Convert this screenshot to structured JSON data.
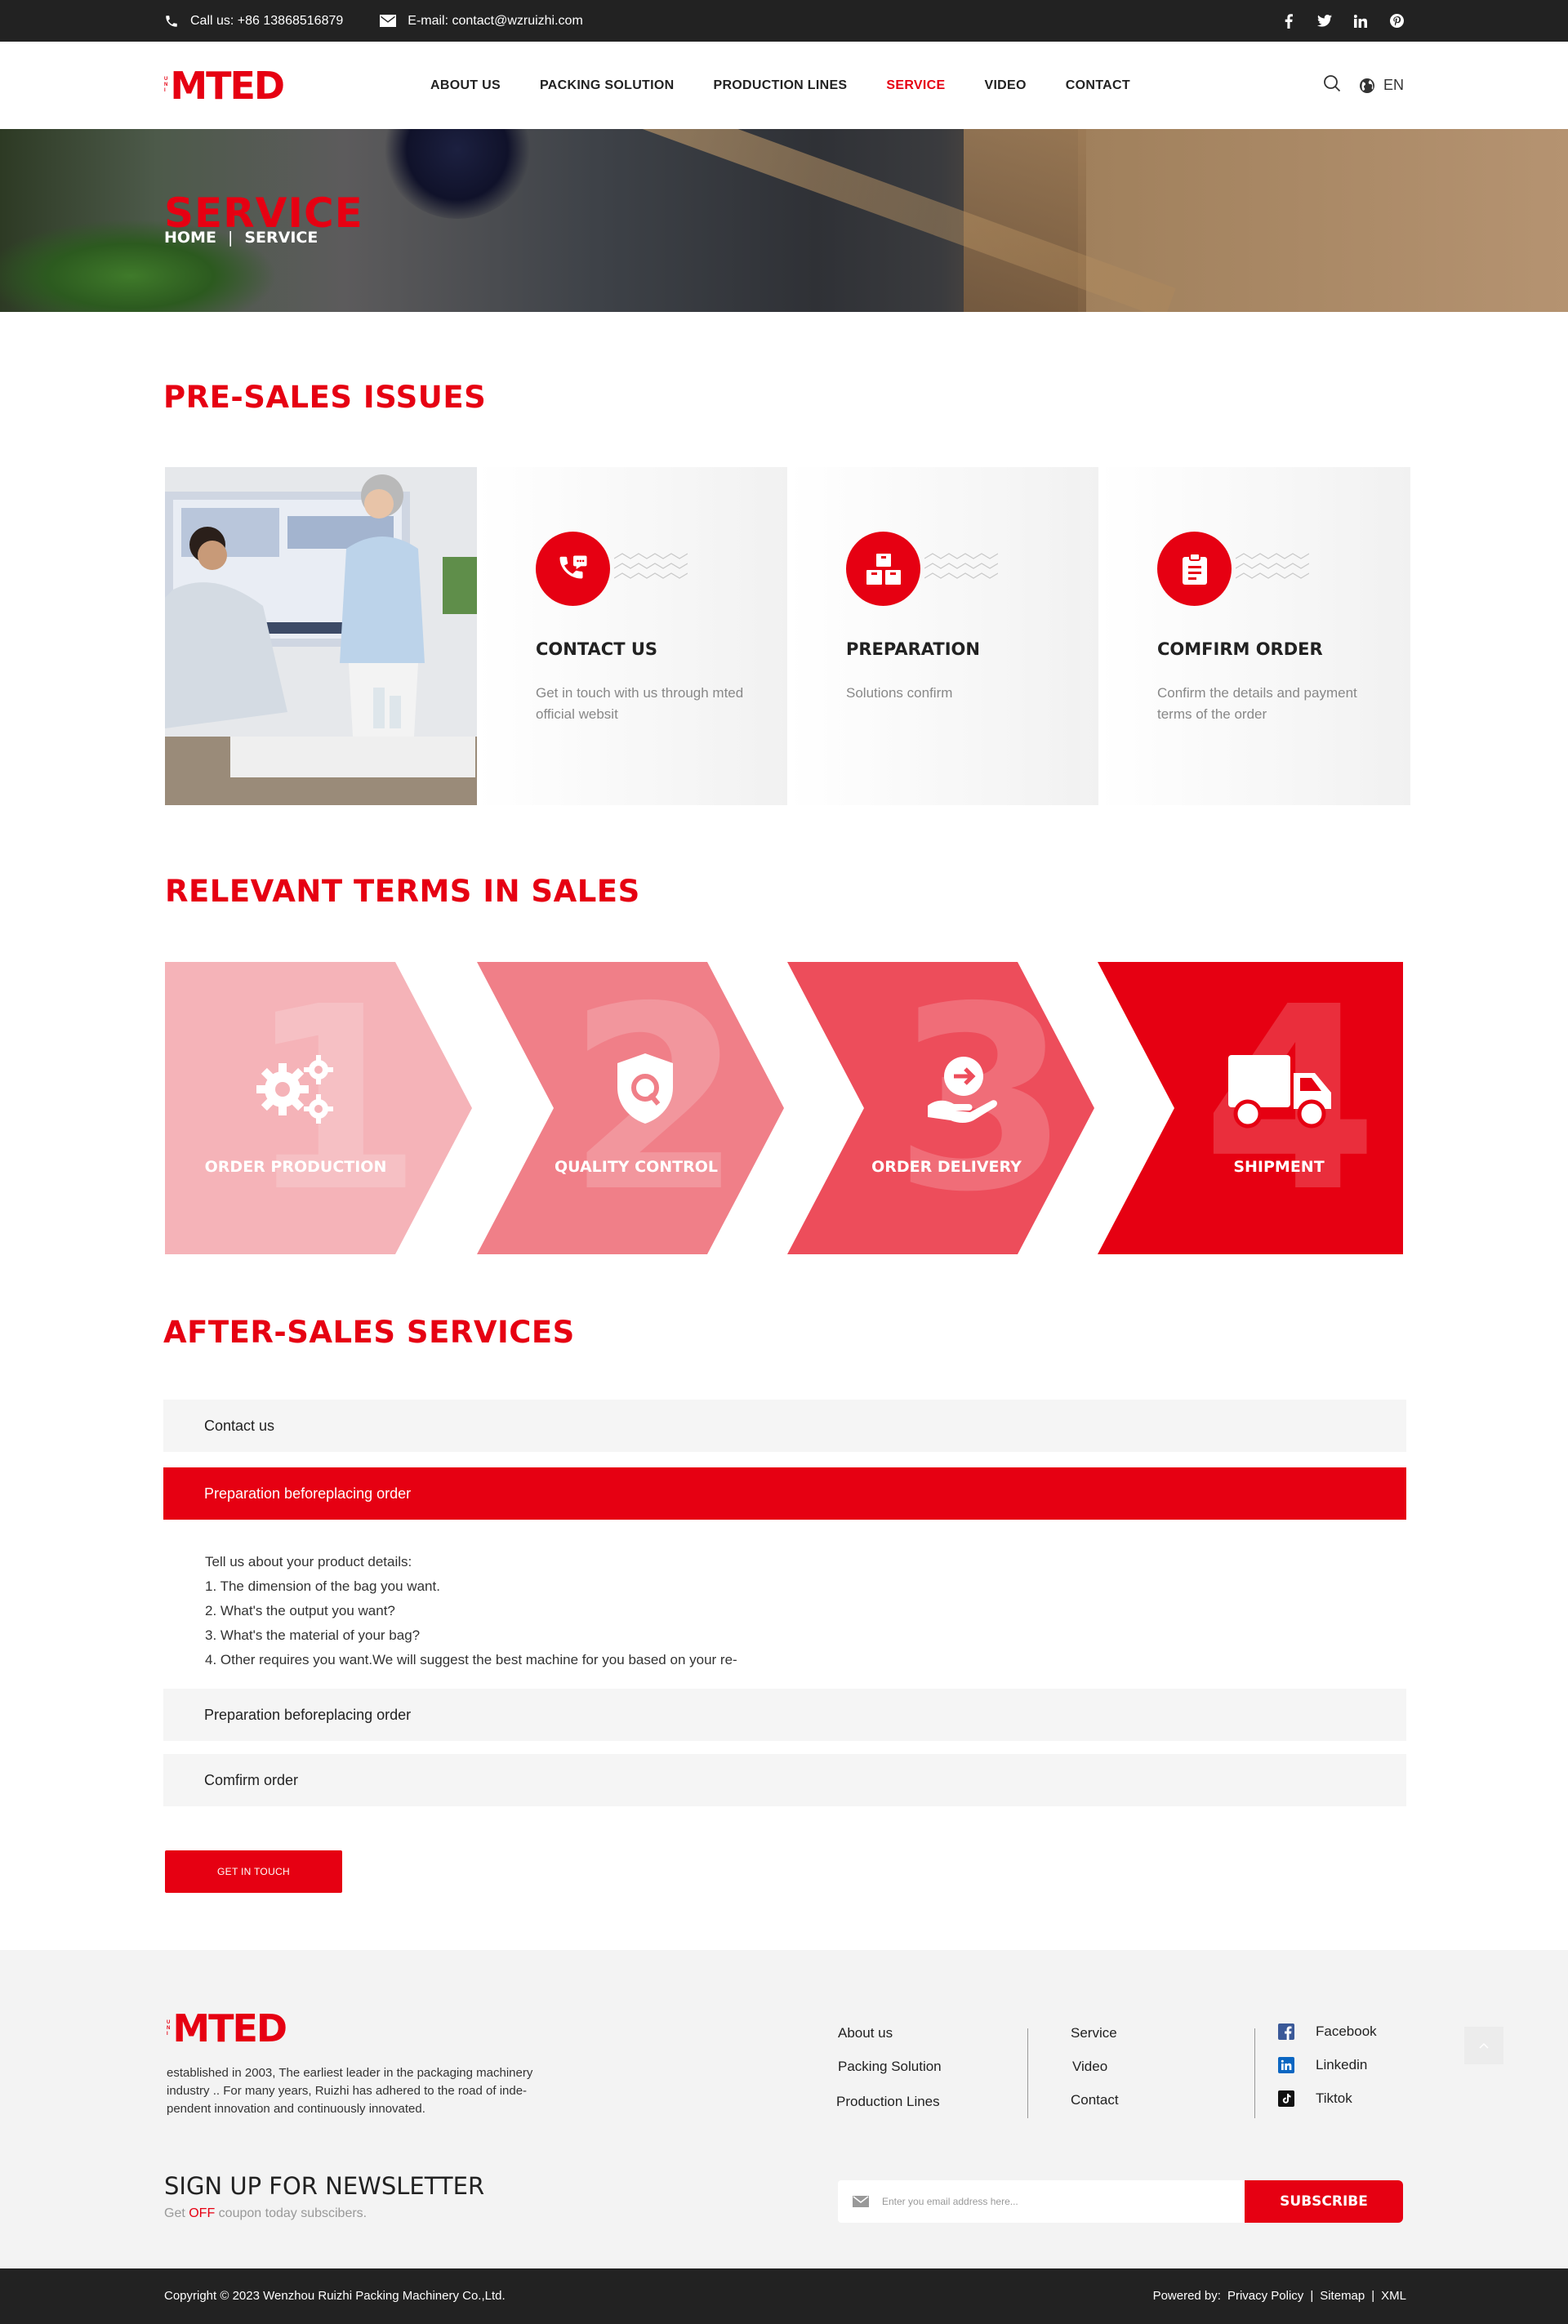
{
  "topbar": {
    "phone": "Call us: +86 13868516879",
    "email": "E-mail: contact@wzruizhi.com",
    "social_icons": [
      "facebook-icon",
      "twitter-icon",
      "linkedin-icon",
      "pinterest-icon"
    ]
  },
  "header": {
    "logo_unit": [
      "U",
      "N",
      "I"
    ],
    "logo_text": "MTED",
    "nav": [
      "ABOUT US",
      "PACKING SOLUTION",
      "PRODUCTION LINES",
      "SERVICE",
      "VIDEO",
      "CONTACT"
    ],
    "active_nav": "SERVICE",
    "lang": "EN"
  },
  "banner": {
    "title": "SERVICE",
    "crumb_home": "HOME",
    "crumb_sep": "|",
    "crumb_current": "SERVICE"
  },
  "pre_sales": {
    "title": "PRE-SALES ISSUES",
    "cards": [
      {
        "title": "CONTACT US",
        "text": "Get in touch with us through mted official websit"
      },
      {
        "title": "PREPARATION",
        "text": "Solutions confirm"
      },
      {
        "title": "COMFIRM ORDER",
        "text": "Confirm the details and payment terms of the order"
      }
    ]
  },
  "terms": {
    "title": "RELEVANT TERMS IN SALES",
    "steps": [
      {
        "num": "1",
        "label": "ORDER PRODUCTION"
      },
      {
        "num": "2",
        "label": "QUALITY CONTROL"
      },
      {
        "num": "3",
        "label": "ORDER DELIVERY"
      },
      {
        "num": "4",
        "label": "SHIPMENT"
      }
    ]
  },
  "after_sales": {
    "title": "AFTER-SALES SERVICES",
    "items": [
      "Contact us",
      "Preparation beforeplacing order",
      "Preparation beforeplacing order",
      "Comfirm order"
    ],
    "body": [
      "Tell us about your product details:",
      "1. The dimension of the bag you want.",
      "2. What's the output you want?",
      "3. What's the material of your bag?",
      "4. Other requires you want.We will suggest the best machine for you based on your re-"
    ],
    "cta": "GET IN TOUCH"
  },
  "footer": {
    "desc": "established in 2003, The earliest leader in the packaging machinery industry .. For many years, Ruizhi has adhered to the road of inde- pendent innovation and continuously innovated.",
    "col1": [
      "About us",
      "Packing Solution",
      "Production Lines"
    ],
    "col2": [
      "Service",
      "Video",
      "Contact"
    ],
    "social": [
      "Facebook",
      "Linkedin",
      "Tiktok"
    ],
    "newsletter_title": "SIGN UP FOR NEWSLETTER",
    "newsletter_sub_pre": "Get ",
    "newsletter_sub_off": "OFF",
    "newsletter_sub_post": " coupon today subscibers.",
    "email_placeholder": "Enter you email address here...",
    "subscribe": "SUBSCRIBE",
    "copyright": "Copyright © 2023 Wenzhou Ruizhi Packing Machinery Co.,Ltd.",
    "powered": "Powered by:",
    "links": [
      "Privacy Policy",
      "|",
      "Sitemap",
      "|",
      "XML"
    ]
  },
  "colors": {
    "brand": "#e60012",
    "dark": "#222222",
    "step1": "#f5b3b8",
    "step2": "#f07f88",
    "step3": "#ed4d5b",
    "step4": "#e60012"
  }
}
